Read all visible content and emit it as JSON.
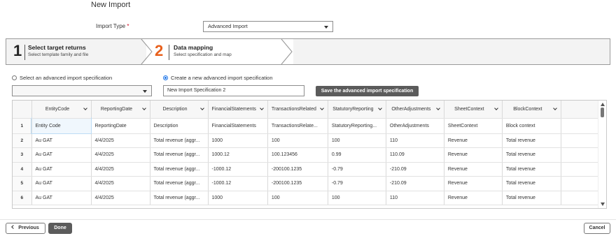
{
  "page": {
    "title": "New Import"
  },
  "import_type": {
    "label": "Import Type",
    "required_mark": "*",
    "value": "Advanced Import"
  },
  "stepper": {
    "steps": [
      {
        "number": "1",
        "title": "Select target returns",
        "subtitle": "Select template family and file",
        "state": "completed"
      },
      {
        "number": "2",
        "title": "Data mapping",
        "subtitle": "Select specification and map",
        "state": "active"
      }
    ],
    "active_color": "#e8601c"
  },
  "spec_choice": {
    "existing_label": "Select an advanced import specification",
    "existing_value": "",
    "new_label": "Create a new advanced import specification",
    "new_value": "New Import Specification 2",
    "selected": "new",
    "save_label": "Save the advanced import specification"
  },
  "grid": {
    "columns": [
      "EntityCode",
      "ReportingDate",
      "Description",
      "FinancialStatements",
      "TransactionsRelated",
      "StatutoryReporting",
      "OtherAdjustments",
      "SheetContext",
      "BlockContext"
    ],
    "rows": [
      {
        "n": "1",
        "cells": [
          "Entity Code",
          "ReportingDate",
          "Description",
          "FinancialStatements",
          "TransactionsRelate...",
          "StatutoryReporting...",
          "OtherAdjustments",
          "SheetContext",
          "Block context"
        ]
      },
      {
        "n": "2",
        "cells": [
          "Au GAT",
          "4/4/2025",
          "Total revenue (aggr...",
          "1000",
          "100",
          "100",
          "110",
          "Revenue",
          "Total revenue"
        ]
      },
      {
        "n": "3",
        "cells": [
          "Au GAT",
          "4/4/2025",
          "Total revenue (aggr...",
          "1000.12",
          "100.123456",
          "0.99",
          "110.09",
          "Revenue",
          "Total revenue"
        ]
      },
      {
        "n": "4",
        "cells": [
          "Au GAT",
          "4/4/2025",
          "Total revenue (aggr...",
          "-1000.12",
          "-200100.1235",
          "-0.79",
          "-210.09",
          "Revenue",
          "Total revenue"
        ]
      },
      {
        "n": "5",
        "cells": [
          "Au GAT",
          "4/4/2025",
          "Total revenue (aggr...",
          "-1000.12",
          "-200100.1235",
          "-0.79",
          "-210.09",
          "Revenue",
          "Total revenue"
        ]
      },
      {
        "n": "6",
        "cells": [
          "Au GAT",
          "4/4/2025",
          "Total revenue (aggr...",
          "1000",
          "100",
          "100",
          "110",
          "Revenue",
          "Total revenue"
        ]
      }
    ]
  },
  "footer": {
    "previous_label": "Previous",
    "done_label": "Done",
    "cancel_label": "Cancel"
  }
}
